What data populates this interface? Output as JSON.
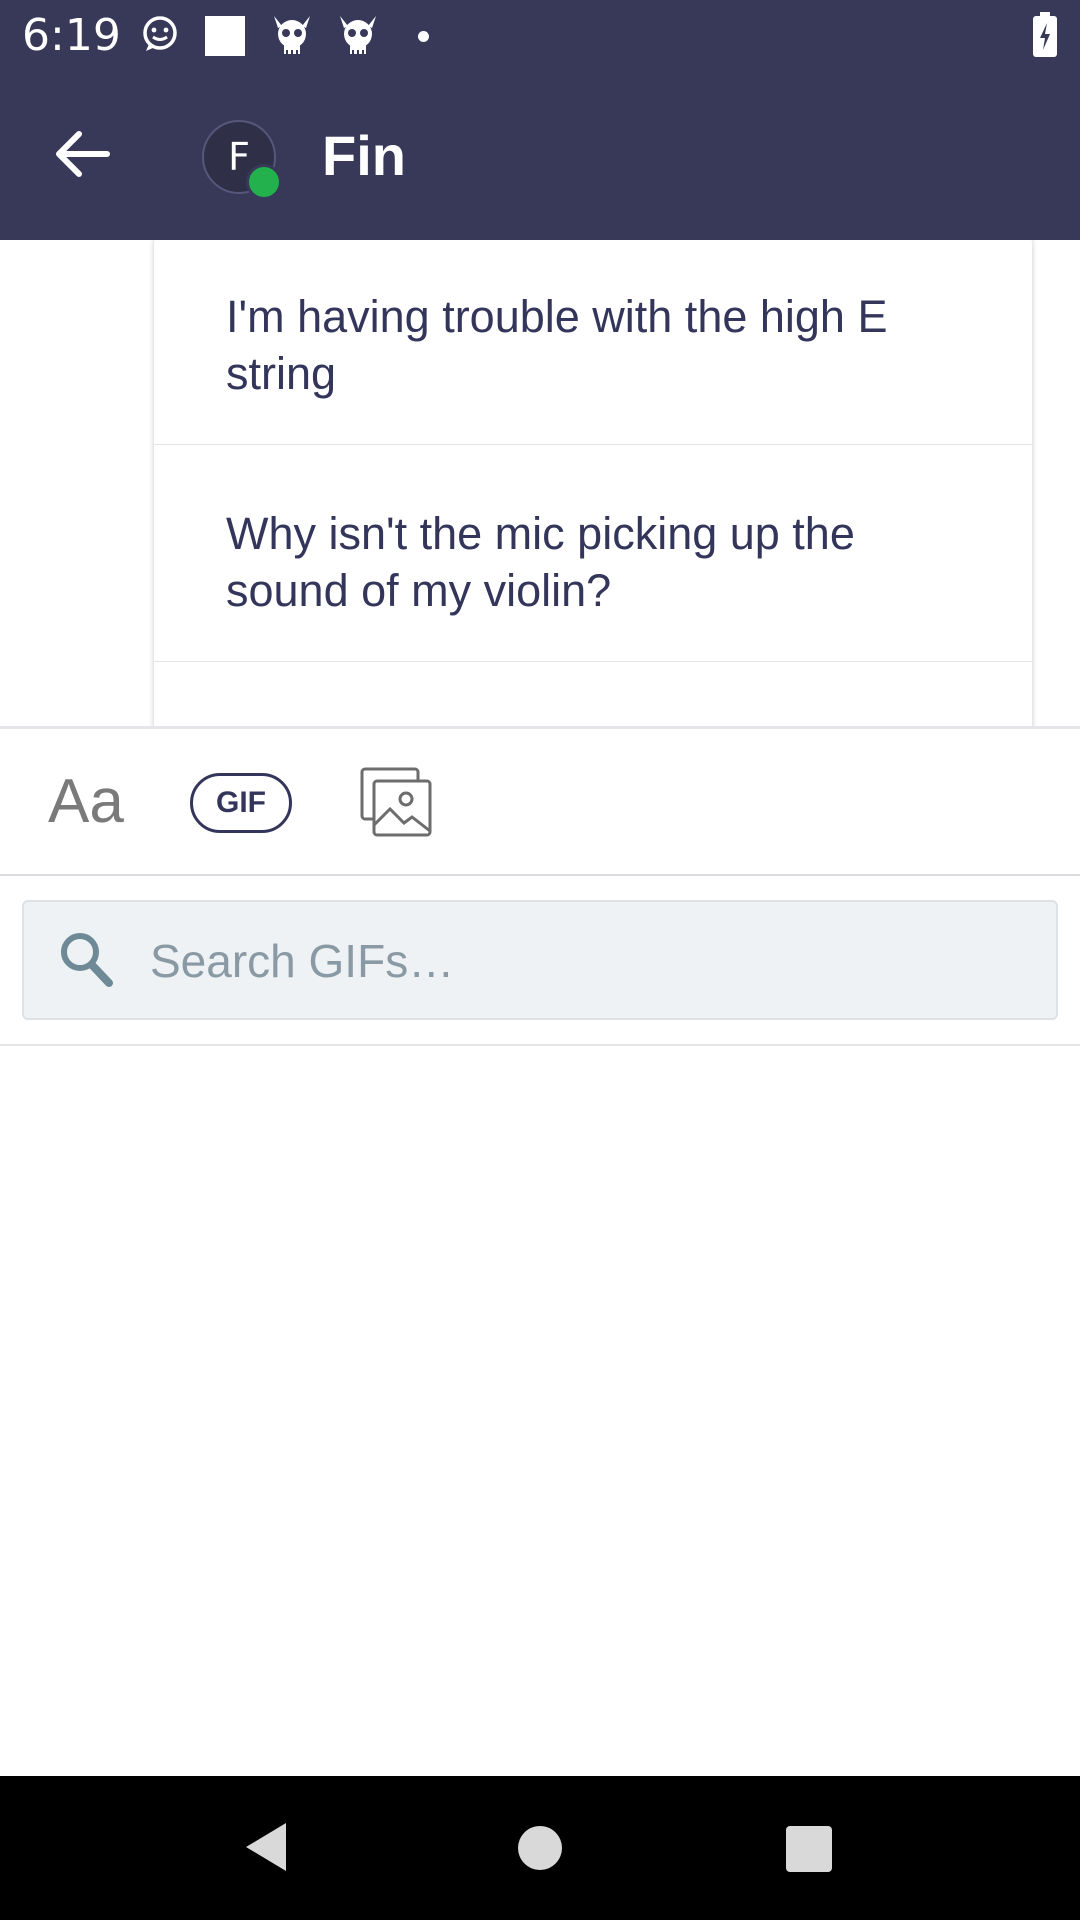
{
  "status_bar": {
    "time": "6:19",
    "icons": [
      "chat-bubble-icon",
      "square-notification-icon",
      "skull-icon",
      "skull-icon",
      "dot-icon",
      "battery-charging-icon"
    ]
  },
  "header": {
    "avatar_initial": "F",
    "contact_name": "Fin",
    "presence_color": "#22b14c",
    "background_color": "#383959"
  },
  "suggestions": [
    {
      "text": "I'm having trouble with the high E string"
    },
    {
      "text": "Why isn't the mic picking up the sound of my violin?"
    }
  ],
  "toolbar": {
    "text_label": "Aa",
    "gif_label": "GIF",
    "image_icon": "image-gallery-icon"
  },
  "search": {
    "placeholder": "Search GIFs…",
    "value": ""
  },
  "nav": {
    "icons": [
      "back-triangle-icon",
      "home-circle-icon",
      "recents-square-icon"
    ]
  }
}
